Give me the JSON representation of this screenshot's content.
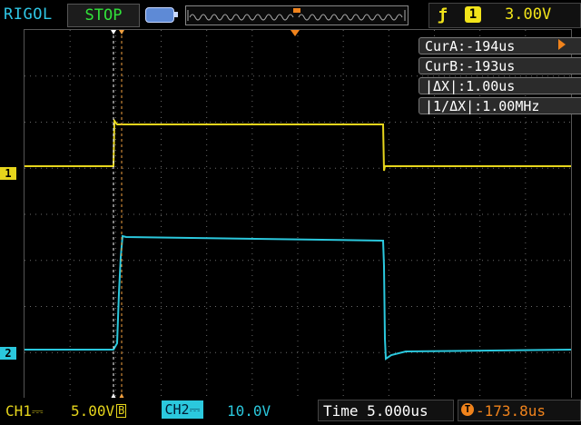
{
  "header": {
    "brand": "RIGOL",
    "run_state": "STOP",
    "trigger": {
      "edge_icon": "rising-edge-icon",
      "source": "1",
      "level": "3.00V"
    }
  },
  "cursors": {
    "cur_a": "CurA:-194us",
    "cur_b": "CurB:-193us",
    "delta_x": "|ΔX|:1.00us",
    "inv_delta_x": "|1/ΔX|:1.00MHz"
  },
  "channels": {
    "ch1": {
      "marker": "1",
      "label": "CH1⎓",
      "scale": "5.00V",
      "bw_flag": "B",
      "color": "#e6d51c"
    },
    "ch2": {
      "marker": "2",
      "label": "CH2⎓",
      "scale": "10.0V",
      "color": "#2bc8dd"
    }
  },
  "footer": {
    "timebase": "Time 5.000us",
    "trigger_position": "-173.8us"
  },
  "colors": {
    "ch1": "#e6d51c",
    "ch2": "#2bc8dd",
    "cursor": "#f0a040",
    "grid": "#6a6a6a",
    "trigger": "#f0831c"
  }
}
